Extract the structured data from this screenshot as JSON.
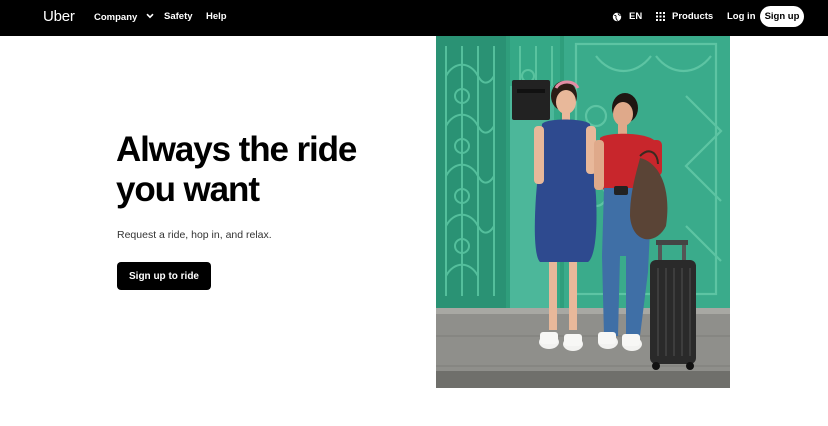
{
  "nav": {
    "logo": "Uber",
    "company": "Company",
    "safety": "Safety",
    "help": "Help",
    "language": "EN",
    "products": "Products",
    "login": "Log in",
    "signup": "Sign up"
  },
  "hero": {
    "title_line1": "Always the ride",
    "title_line2": "you want",
    "subtitle": "Request a ride, hop in, and relax.",
    "cta": "Sign up to ride"
  },
  "colors": {
    "nav_bg": "#000000",
    "wall_green": "#2f9e7c",
    "dress_blue": "#2e4a8f",
    "shirt_red": "#c8262c",
    "jeans_blue": "#3f6fa6",
    "sidewalk": "#8a8a86"
  },
  "icons": {
    "globe": "globe-icon",
    "grid": "grid-icon",
    "chevron": "chevron-down-icon"
  }
}
